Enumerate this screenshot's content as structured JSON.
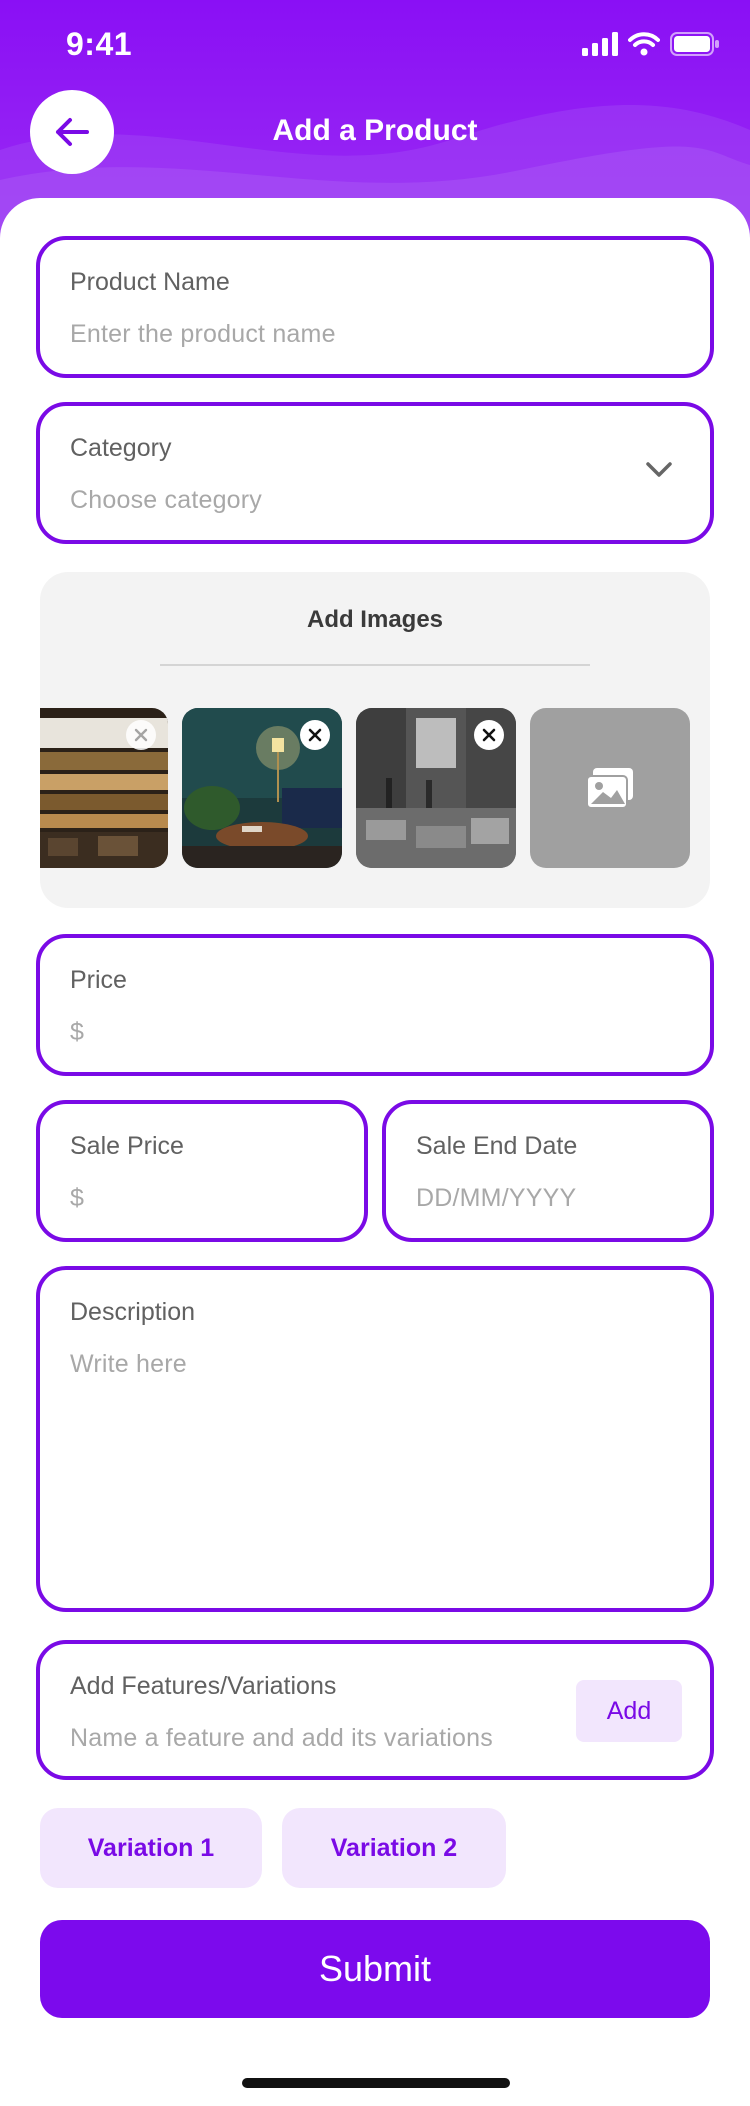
{
  "status_bar": {
    "time": "9:41"
  },
  "header": {
    "title": "Add a Product"
  },
  "form": {
    "product_name": {
      "label": "Product Name",
      "placeholder": "Enter the product name"
    },
    "category": {
      "label": "Category",
      "placeholder": "Choose category"
    },
    "images": {
      "title": "Add Images",
      "thumbnail_count": 3
    },
    "price": {
      "label": "Price",
      "placeholder": "$"
    },
    "sale_price": {
      "label": "Sale Price",
      "placeholder": "$"
    },
    "sale_end_date": {
      "label": "Sale End Date",
      "placeholder": "DD/MM/YYYY"
    },
    "description": {
      "label": "Description",
      "placeholder": "Write here"
    },
    "features": {
      "label": "Add Features/Variations",
      "placeholder": "Name a feature and add its variations",
      "add_label": "Add"
    },
    "variations": [
      "Variation 1",
      "Variation 2"
    ],
    "submit_label": "Submit"
  },
  "colors": {
    "accent": "#7a0ae6",
    "chip_bg": "#f2e6fd",
    "header": "#8a0ff5"
  },
  "icons": [
    "back-arrow-icon",
    "chevron-down-icon",
    "close-icon",
    "add-image-icon",
    "signal-icon",
    "wifi-icon",
    "battery-icon"
  ]
}
